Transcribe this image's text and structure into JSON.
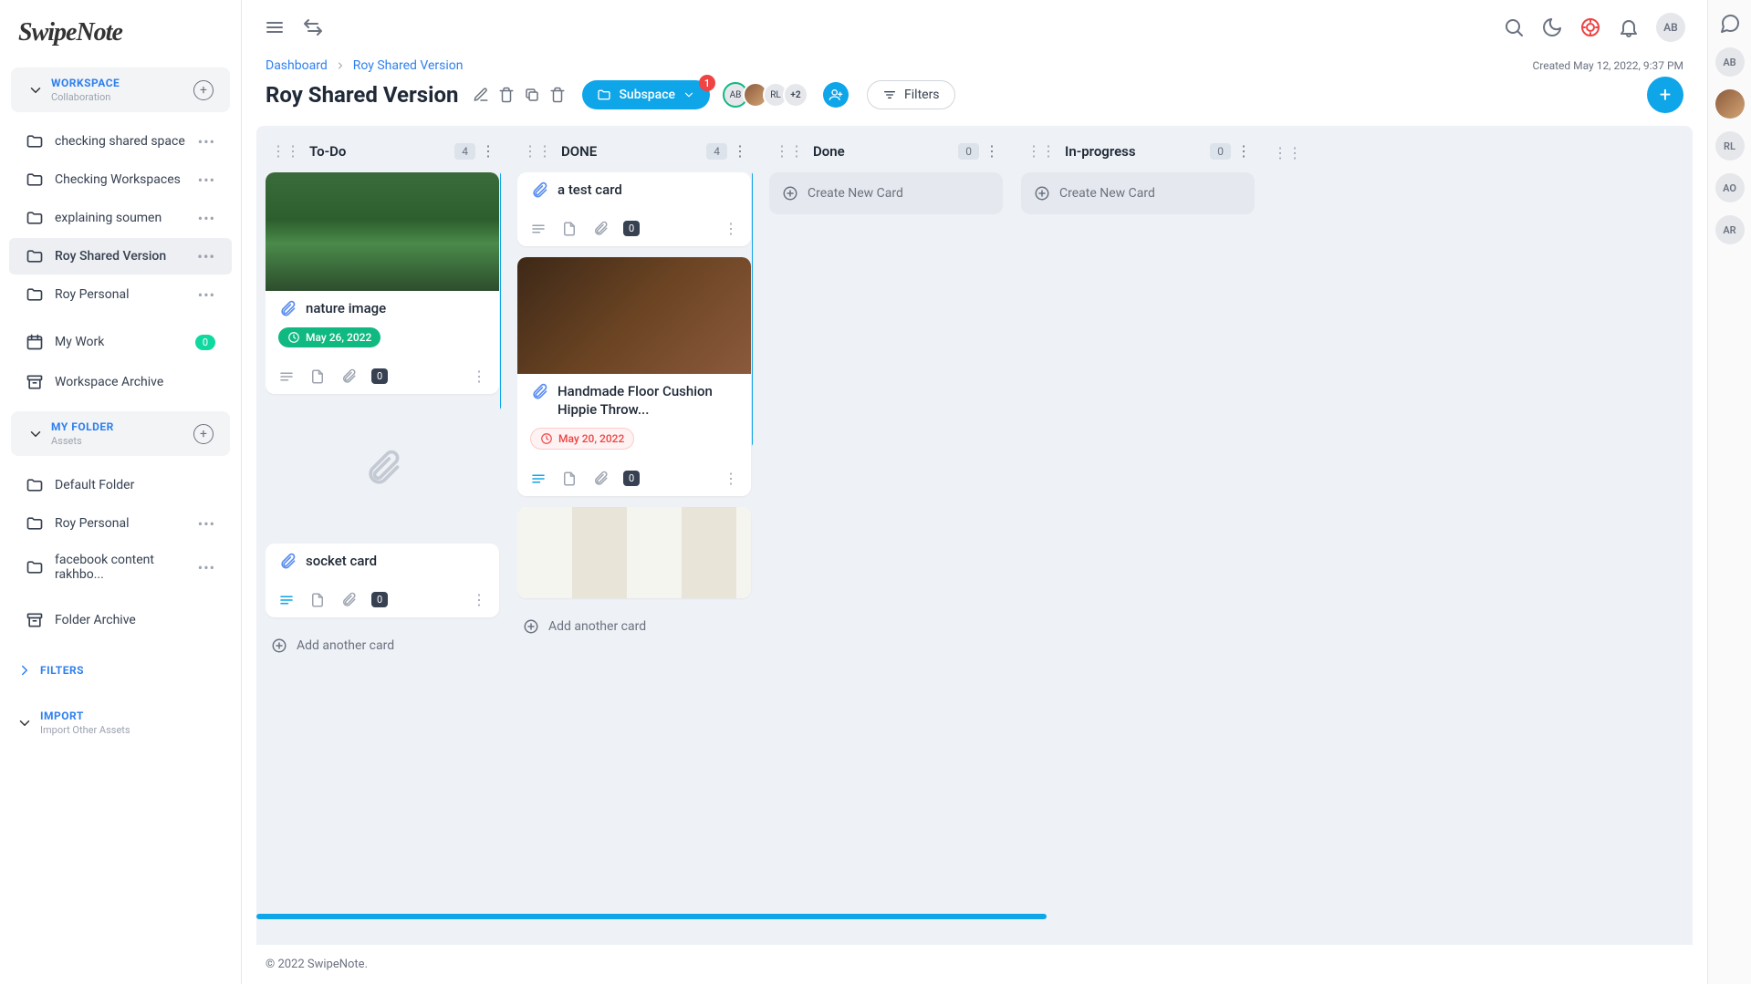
{
  "logo": "SwipeNote",
  "sidebar": {
    "workspace": {
      "title": "WORKSPACE",
      "subtitle": "Collaboration"
    },
    "ws_items": [
      {
        "label": "checking shared space"
      },
      {
        "label": "Checking Workspaces"
      },
      {
        "label": "explaining soumen"
      },
      {
        "label": "Roy Shared Version"
      },
      {
        "label": "Roy Personal"
      }
    ],
    "my_work": "My Work",
    "my_work_count": "0",
    "archive": "Workspace Archive",
    "myfolder": {
      "title": "MY FOLDER",
      "subtitle": "Assets"
    },
    "folder_items": [
      {
        "label": "Default Folder"
      },
      {
        "label": "Roy Personal"
      },
      {
        "label": "facebook content rakhbo..."
      }
    ],
    "folder_archive": "Folder Archive",
    "filters": "FILTERS",
    "import": {
      "title": "IMPORT",
      "subtitle": "Import Other Assets"
    }
  },
  "breadcrumb": {
    "a": "Dashboard",
    "b": "Roy Shared Version"
  },
  "created": "Created May 12, 2022, 9:37 PM",
  "page_title": "Roy Shared Version",
  "subspace": "Subspace",
  "subspace_badge": "1",
  "avatar_more": "+2",
  "filters_btn": "Filters",
  "user_initials": "AB",
  "avatars": {
    "a": "AB",
    "b": "RL"
  },
  "columns": [
    {
      "title": "To-Do",
      "count": "4"
    },
    {
      "title": "DONE",
      "count": "4"
    },
    {
      "title": "Done",
      "count": "0"
    },
    {
      "title": "In-progress",
      "count": "0"
    }
  ],
  "cards": {
    "nature": {
      "title": "nature image",
      "date": "May 26, 2022",
      "comments": "0"
    },
    "socket": {
      "title": "socket card",
      "comments": "0"
    },
    "test": {
      "title": "a test card",
      "comments": "0"
    },
    "cushion": {
      "title": "Handmade Floor Cushion Hippie Throw...",
      "date": "May 20, 2022",
      "comments": "0"
    }
  },
  "create_card": "Create New Card",
  "add_another": "Add another card",
  "footer": "© 2022 SwipeNote.",
  "rail": [
    "AB",
    "RL",
    "AO",
    "AR"
  ]
}
